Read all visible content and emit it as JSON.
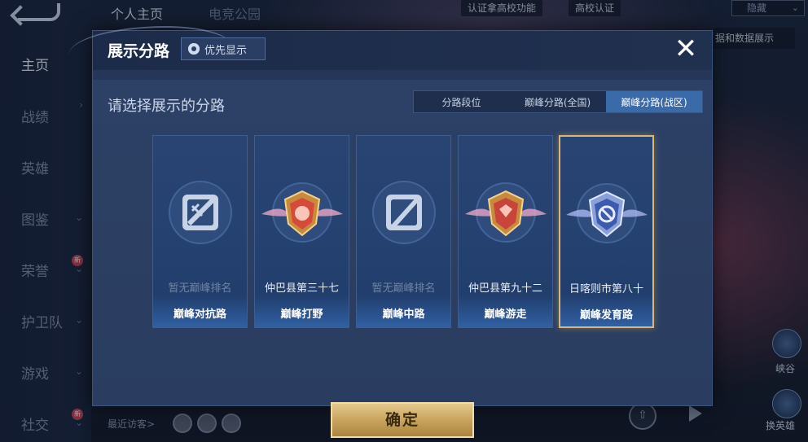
{
  "background": {
    "top_tabs": [
      "个人主页",
      "电竞公园"
    ],
    "top_pills": [
      "认证拿高校功能",
      "高校认证"
    ],
    "top_dropdown": "隐藏",
    "data_note": "据和数据展示",
    "nav_items": [
      {
        "label": "主页",
        "active": true,
        "chevron": false,
        "badge": false
      },
      {
        "label": "战绩",
        "active": false,
        "chevron": false,
        "badge": false
      },
      {
        "label": "英雄",
        "active": false,
        "chevron": false,
        "badge": false
      },
      {
        "label": "图鉴",
        "active": false,
        "chevron": true,
        "badge": false
      },
      {
        "label": "荣誉",
        "active": false,
        "chevron": true,
        "badge": true
      },
      {
        "label": "护卫队",
        "active": false,
        "chevron": true,
        "badge": false
      },
      {
        "label": "游戏",
        "active": false,
        "chevron": true,
        "badge": false
      },
      {
        "label": "社交",
        "active": false,
        "chevron": true,
        "badge": true
      }
    ],
    "badge_text": "新",
    "visitors_label": "最近访客>",
    "right_buttons": [
      "峡谷",
      "换英雄"
    ]
  },
  "modal": {
    "title": "展示分路",
    "priority_label": "优先显示",
    "close_icon": "close-icon",
    "prompt": "请选择展示的分路",
    "segments": [
      "分路段位",
      "巅峰分路(全国)",
      "巅峰分路(战区)"
    ],
    "active_segment": 2,
    "cards": [
      {
        "rank": "暂无巅峰排名",
        "label": "巅峰对抗路",
        "emblem": "clash-lane-icon",
        "has_rank": false,
        "selected": false
      },
      {
        "rank": "仲巴县第三十七",
        "label": "巅峰打野",
        "emblem": "jungle-medal-icon",
        "has_rank": true,
        "selected": false
      },
      {
        "rank": "暂无巅峰排名",
        "label": "巅峰中路",
        "emblem": "mid-lane-icon",
        "has_rank": false,
        "selected": false
      },
      {
        "rank": "仲巴县第九十二",
        "label": "巅峰游走",
        "emblem": "roam-medal-icon",
        "has_rank": true,
        "selected": false
      },
      {
        "rank": "日喀则市第八十",
        "label": "巅峰发育路",
        "emblem": "farm-medal-icon",
        "has_rank": true,
        "selected": true
      }
    ],
    "confirm_label": "确定"
  }
}
